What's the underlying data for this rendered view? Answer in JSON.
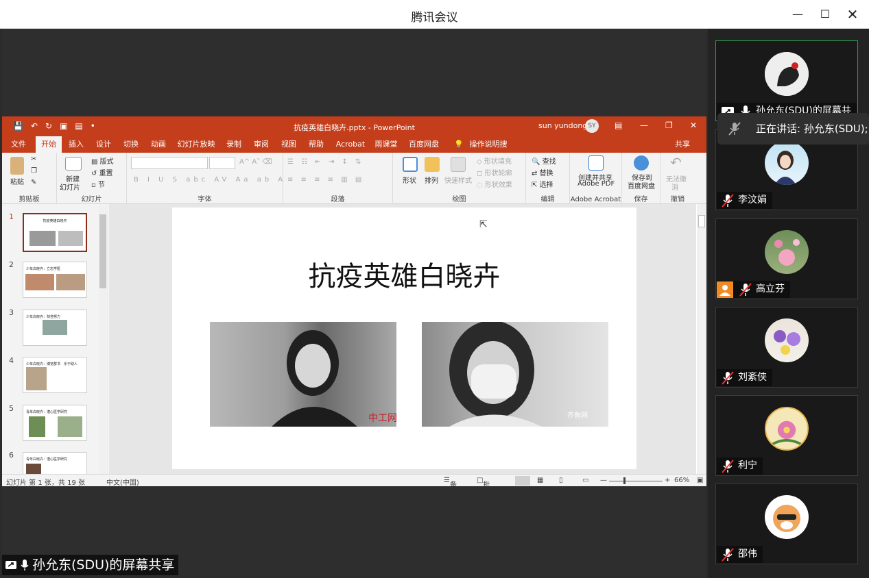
{
  "window": {
    "title": "腾讯会议"
  },
  "share_label": "孙允东(SDU)的屏幕共享",
  "speaking": "正在讲话: 孙允东(SDU);",
  "participants": [
    {
      "name": "孙允东(SDU)的屏幕共",
      "muted": false
    },
    {
      "name": "李汶娟",
      "muted": true
    },
    {
      "name": "高立芬",
      "muted": true
    },
    {
      "name": "刘紊侠",
      "muted": true
    },
    {
      "name": "利宁",
      "muted": true
    },
    {
      "name": "邵伟",
      "muted": true
    }
  ],
  "ppt": {
    "doc_title": "抗疫英雄白晓卉.pptx - PowerPoint",
    "user": "sun yundong",
    "user_initials": "SY",
    "tabs": [
      "文件",
      "开始",
      "插入",
      "设计",
      "切换",
      "动画",
      "幻灯片放映",
      "录制",
      "审阅",
      "视图",
      "帮助",
      "Acrobat",
      "雨课堂",
      "百度网盘"
    ],
    "tell_me": "操作说明搜索",
    "share": "共享",
    "ribbon": {
      "paste": "粘贴",
      "clipboard": "剪贴板",
      "new_slide_1": "新建",
      "new_slide_2": "幻灯片",
      "layout": "版式",
      "reset": "重置",
      "section": "节",
      "slides": "幻灯片",
      "font": "字体",
      "paragraph": "段落",
      "shape": "形状",
      "arrange": "排列",
      "quick_styles": "快速样式",
      "shape_fill": "形状填充",
      "shape_outline": "形状轮廓",
      "shape_effects": "形状效果",
      "drawing": "绘图",
      "find": "查找",
      "replace": "替换",
      "select": "选择",
      "editing": "编辑",
      "create_pdf_1": "创建并共享",
      "create_pdf_2": "Adobe PDF",
      "adobe_acrobat": "Adobe Acrobat",
      "save_baidu_1": "保存到",
      "save_baidu_2": "百度网盘",
      "save": "保存",
      "undo_1": "无法撤",
      "undo_2": "消",
      "undo_group": "撤销"
    },
    "slide_title": "抗疫英雄白晓卉",
    "thumbnails": [
      {
        "num": "1",
        "title": "抗疫英雄白晓卉"
      },
      {
        "num": "2",
        "title": "少年白晓卉：立志学医"
      },
      {
        "num": "3",
        "title": "少年白晓卉：刻苦努力"
      },
      {
        "num": "4",
        "title": "少年白晓卉：博览群书　乐于助人"
      },
      {
        "num": "5",
        "title": "青年白晓卉：潜心医学研究"
      },
      {
        "num": "6",
        "title": "青年白晓卉：潜心医学研究"
      }
    ],
    "status": {
      "slide_info": "幻灯片 第 1 张，共 19 张",
      "language": "中文(中国)",
      "notes": "备注",
      "comments": "批注",
      "zoom": "66%"
    },
    "watermark_left": "中工网",
    "watermark_right": "齐鲁网"
  }
}
